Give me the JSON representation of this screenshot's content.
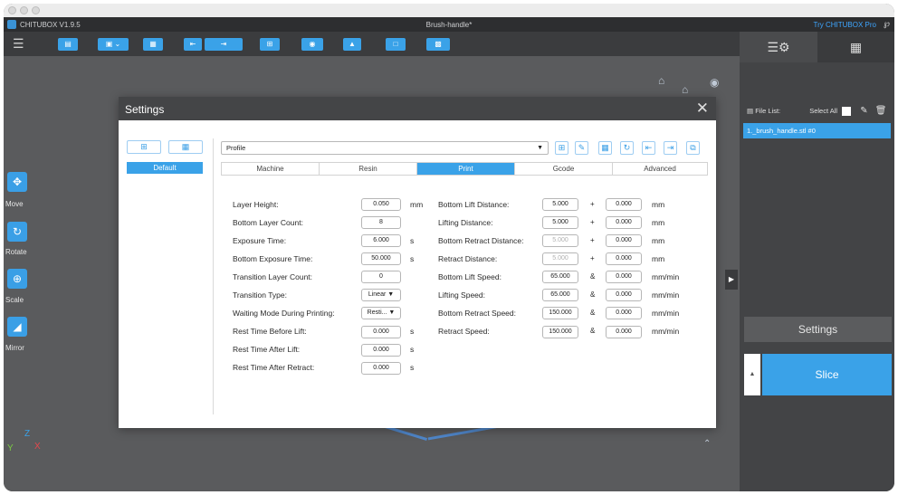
{
  "titlebar": {
    "app_name": "CHITUBOX V1.9.5",
    "doc_title": "Brush-handle*",
    "pro_link": "Try CHITUBOX Pro",
    "user_icon": "user-icon"
  },
  "toolbar": {
    "menu_icon": "hamburger-icon"
  },
  "left_tools": [
    {
      "label": "Move",
      "icon": "move-icon"
    },
    {
      "label": "Rotate",
      "icon": "rotate-icon"
    },
    {
      "label": "Scale",
      "icon": "scale-icon"
    },
    {
      "label": "Mirror",
      "icon": "mirror-icon"
    }
  ],
  "axes": {
    "z": "Z",
    "y": "Y",
    "x": "X"
  },
  "right_panel": {
    "file_list_label": "File List:",
    "select_all_label": "Select All",
    "file_item": "1._brush_handle.stl #0",
    "settings_label": "Settings",
    "slice_label": "Slice"
  },
  "settings_dialog": {
    "title": "Settings",
    "profile_group": "Default",
    "profile_selected": "Profile",
    "tabs": [
      "Machine",
      "Resin",
      "Print",
      "Gcode",
      "Advanced"
    ],
    "active_tab": "Print",
    "left_fields": [
      {
        "label": "Layer Height:",
        "value": "0.050",
        "unit": "mm"
      },
      {
        "label": "Bottom Layer Count:",
        "value": "8",
        "unit": ""
      },
      {
        "label": "Exposure Time:",
        "value": "6.000",
        "unit": "s"
      },
      {
        "label": "Bottom Exposure Time:",
        "value": "50.000",
        "unit": "s"
      },
      {
        "label": "Transition Layer Count:",
        "value": "0",
        "unit": ""
      },
      {
        "label": "Transition Type:",
        "value": "Linear ▼",
        "unit": ""
      },
      {
        "label": "Waiting Mode During Printing:",
        "value": "Resti... ▼",
        "unit": ""
      },
      {
        "label": "Rest Time Before Lift:",
        "value": "0.000",
        "unit": "s"
      },
      {
        "label": "Rest Time After Lift:",
        "value": "0.000",
        "unit": "s"
      },
      {
        "label": "Rest Time After Retract:",
        "value": "0.000",
        "unit": "s"
      }
    ],
    "right_fields": [
      {
        "label": "Bottom Lift Distance:",
        "value1": "5.000",
        "sym": "+",
        "value2": "0.000",
        "unit": "mm",
        "disabled": false
      },
      {
        "label": "Lifting Distance:",
        "value1": "5.000",
        "sym": "+",
        "value2": "0.000",
        "unit": "mm",
        "disabled": false
      },
      {
        "label": "Bottom Retract Distance:",
        "value1": "5.000",
        "sym": "+",
        "value2": "0.000",
        "unit": "mm",
        "disabled": true
      },
      {
        "label": "Retract Distance:",
        "value1": "5.000",
        "sym": "+",
        "value2": "0.000",
        "unit": "mm",
        "disabled": true
      },
      {
        "label": "Bottom Lift Speed:",
        "value1": "65.000",
        "sym": "&",
        "value2": "0.000",
        "unit": "mm/min",
        "disabled": false
      },
      {
        "label": "Lifting Speed:",
        "value1": "65.000",
        "sym": "&",
        "value2": "0.000",
        "unit": "mm/min",
        "disabled": false
      },
      {
        "label": "Bottom Retract Speed:",
        "value1": "150.000",
        "sym": "&",
        "value2": "0.000",
        "unit": "mm/min",
        "disabled": false
      },
      {
        "label": "Retract Speed:",
        "value1": "150.000",
        "sym": "&",
        "value2": "0.000",
        "unit": "mm/min",
        "disabled": false
      }
    ]
  },
  "colors": {
    "accent": "#3aa2e8",
    "dialog_header": "#444547",
    "viewport": "#5a5b5d"
  }
}
